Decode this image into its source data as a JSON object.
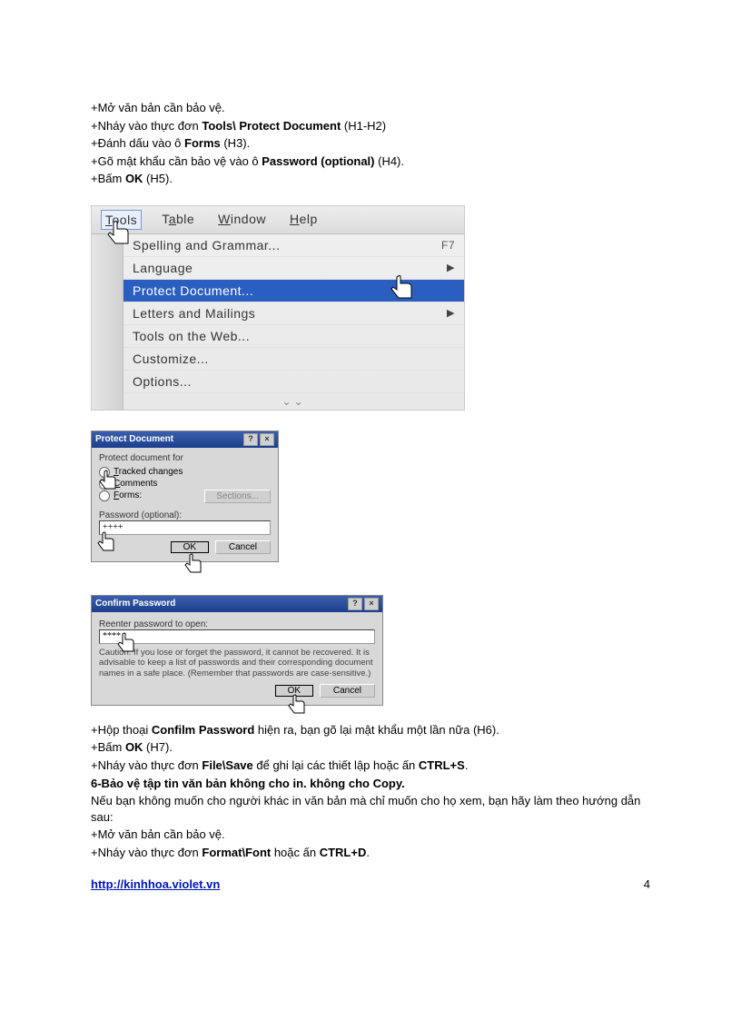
{
  "instructions1": {
    "line1": "+Mở văn bản cần bảo vệ.",
    "line2_prefix": "+Nháy vào thực đơn ",
    "line2_bold": "Tools\\ Protect Document",
    "line2_suffix": " (H1-H2)",
    "line3_prefix": "+Đánh dấu vào ô ",
    "line3_bold": "Forms",
    "line3_suffix": " (H3).",
    "line4_prefix": "+Gõ mật khẩu cần bảo vệ vào ô ",
    "line4_bold": "Password (optional)",
    "line4_suffix": " (H4).",
    "line5_prefix": "+Bấm ",
    "line5_bold": "OK",
    "line5_suffix": " (H5)."
  },
  "menubar": {
    "tools": "Tools",
    "table": "Table",
    "window": "Window",
    "help": "Help"
  },
  "menu": {
    "spelling": "Spelling and Grammar...",
    "spelling_shortcut": "F7",
    "language": "Language",
    "protect": "Protect Document...",
    "letters": "Letters and Mailings",
    "web": "Tools on the Web...",
    "customize": "Customize...",
    "options": "Options..."
  },
  "dialog1": {
    "title": "Protect Document",
    "group": "Protect document for",
    "opt_tracked": "Tracked changes",
    "opt_comments": "Comments",
    "opt_forms": "Forms:",
    "sections_btn": "Sections...",
    "pw_label": "Password (optional):",
    "pw_value": "++++",
    "ok": "OK",
    "cancel": "Cancel"
  },
  "dialog2": {
    "title": "Confirm Password",
    "reenter": "Reenter password to open:",
    "pw_value": "****",
    "caution": "Caution: If you lose or forget the password, it cannot be recovered. It is advisable to keep a list of passwords and their corresponding document names in a safe place. (Remember that passwords are case-sensitive.)",
    "ok": "OK",
    "cancel": "Cancel"
  },
  "instructions2": {
    "l1_prefix": "+Hộp thoại ",
    "l1_bold": "Confilm Password",
    "l1_suffix": " hiện ra, bạn gõ lại mật khẩu một lần nữa (H6).",
    "l2_prefix": "+Bấm ",
    "l2_bold": "OK",
    "l2_suffix": " (H7).",
    "l3_prefix": "+Nháy vào thực đơn ",
    "l3_bold": "File\\Save",
    "l3_mid": " để ghi lại các thiết lập hoặc ấn ",
    "l3_bold2": "CTRL+S",
    "l3_suffix": "."
  },
  "section6": {
    "heading": "6-Bảo vệ tập tin văn bản không cho in. không cho Copy.",
    "l1": "Nếu bạn không muốn cho người khác in văn bản mà chỉ muốn cho họ xem, bạn hãy làm theo hướng dẫn sau:",
    "l2": "+Mở văn bản cần bảo vệ.",
    "l3_prefix": "+Nháy vào thực đơn ",
    "l3_bold": "Format\\Font",
    "l3_mid": " hoặc ấn ",
    "l3_bold2": "CTRL+D",
    "l3_suffix": "."
  },
  "footer": {
    "url": "http://kinhhoa.violet.vn",
    "page": "4"
  }
}
